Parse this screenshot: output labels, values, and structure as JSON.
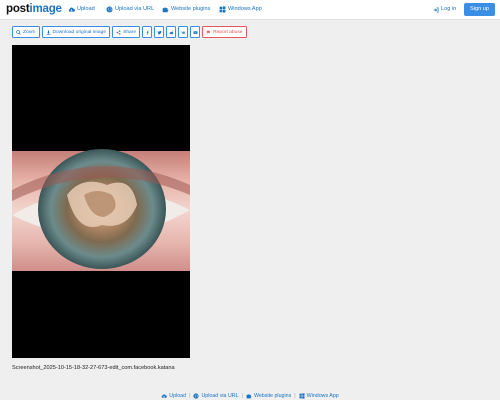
{
  "header": {
    "logo_post": "post",
    "logo_image": "image",
    "nav": [
      {
        "label": "Upload",
        "icon": "cloud-upload-icon"
      },
      {
        "label": "Upload via URL",
        "icon": "globe-icon"
      },
      {
        "label": "Website plugins",
        "icon": "puzzle-icon"
      },
      {
        "label": "Windows App",
        "icon": "windows-icon"
      }
    ],
    "login_label": "Log in",
    "signup_label": "Sign up"
  },
  "toolbar": {
    "zoom_label": "Zoom",
    "download_label": "Download original image",
    "share_label": "Share",
    "report_label": "Report abuse",
    "social_icons": [
      "facebook-icon",
      "twitter-icon",
      "reddit-icon",
      "vk-icon",
      "email-icon"
    ]
  },
  "image": {
    "filename": "Screenshot_2025-10-15-18-32-27-673-edit_com.facebook.katana"
  },
  "footer": {
    "links": [
      {
        "label": "Upload",
        "icon": "cloud-upload-icon"
      },
      {
        "label": "Upload via URL",
        "icon": "globe-icon"
      },
      {
        "label": "Website plugins",
        "icon": "puzzle-icon"
      },
      {
        "label": "Windows App",
        "icon": "windows-icon"
      }
    ]
  },
  "colors": {
    "accent": "#1a74c6",
    "button": "#3a8ee6",
    "report": "#d9534f",
    "background": "#efefef"
  }
}
